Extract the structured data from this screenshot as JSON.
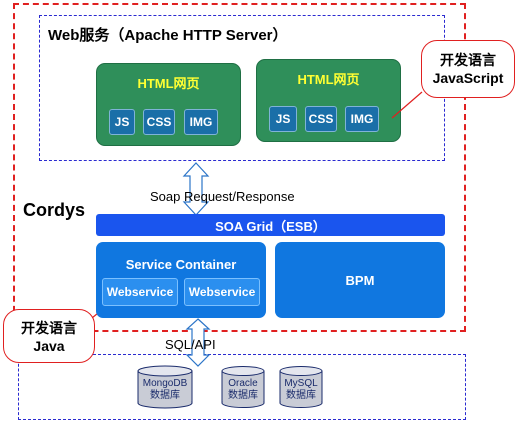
{
  "web_service": {
    "title": "Web服务（Apache HTTP Server）"
  },
  "html_pages": [
    {
      "title": "HTML网页",
      "chips": [
        "JS",
        "CSS",
        "IMG"
      ]
    },
    {
      "title": "HTML网页",
      "chips": [
        "JS",
        "CSS",
        "IMG"
      ]
    }
  ],
  "callout_js": {
    "line1": "开发语言",
    "line2": "JavaScript"
  },
  "callout_java": {
    "line1": "开发语言",
    "line2": "Java"
  },
  "cordys_label": "Cordys",
  "soap_label": "Soap Request/Response",
  "soa_grid_label": "SOA Grid（ESB）",
  "service_container": {
    "title": "Service Container",
    "items": [
      "Webservice",
      "Webservice"
    ]
  },
  "bpm_label": "BPM",
  "sql_label": "SQL/API",
  "databases": [
    {
      "name": "MongoDB",
      "sub": "数据库"
    },
    {
      "name": "Oracle",
      "sub": "数据库"
    },
    {
      "name": "MySQL",
      "sub": "数据库"
    }
  ],
  "colors": {
    "cordys_border": "#e02020",
    "web_border": "#2a2ad0",
    "html_page_fill": "#2f8f5a",
    "html_title_text": "#ffff33",
    "chip_fill": "#1a6fa8",
    "soa_grid_fill": "#1a55ee",
    "service_fill": "#1077e0",
    "db_fill": "#c9ccd6"
  }
}
